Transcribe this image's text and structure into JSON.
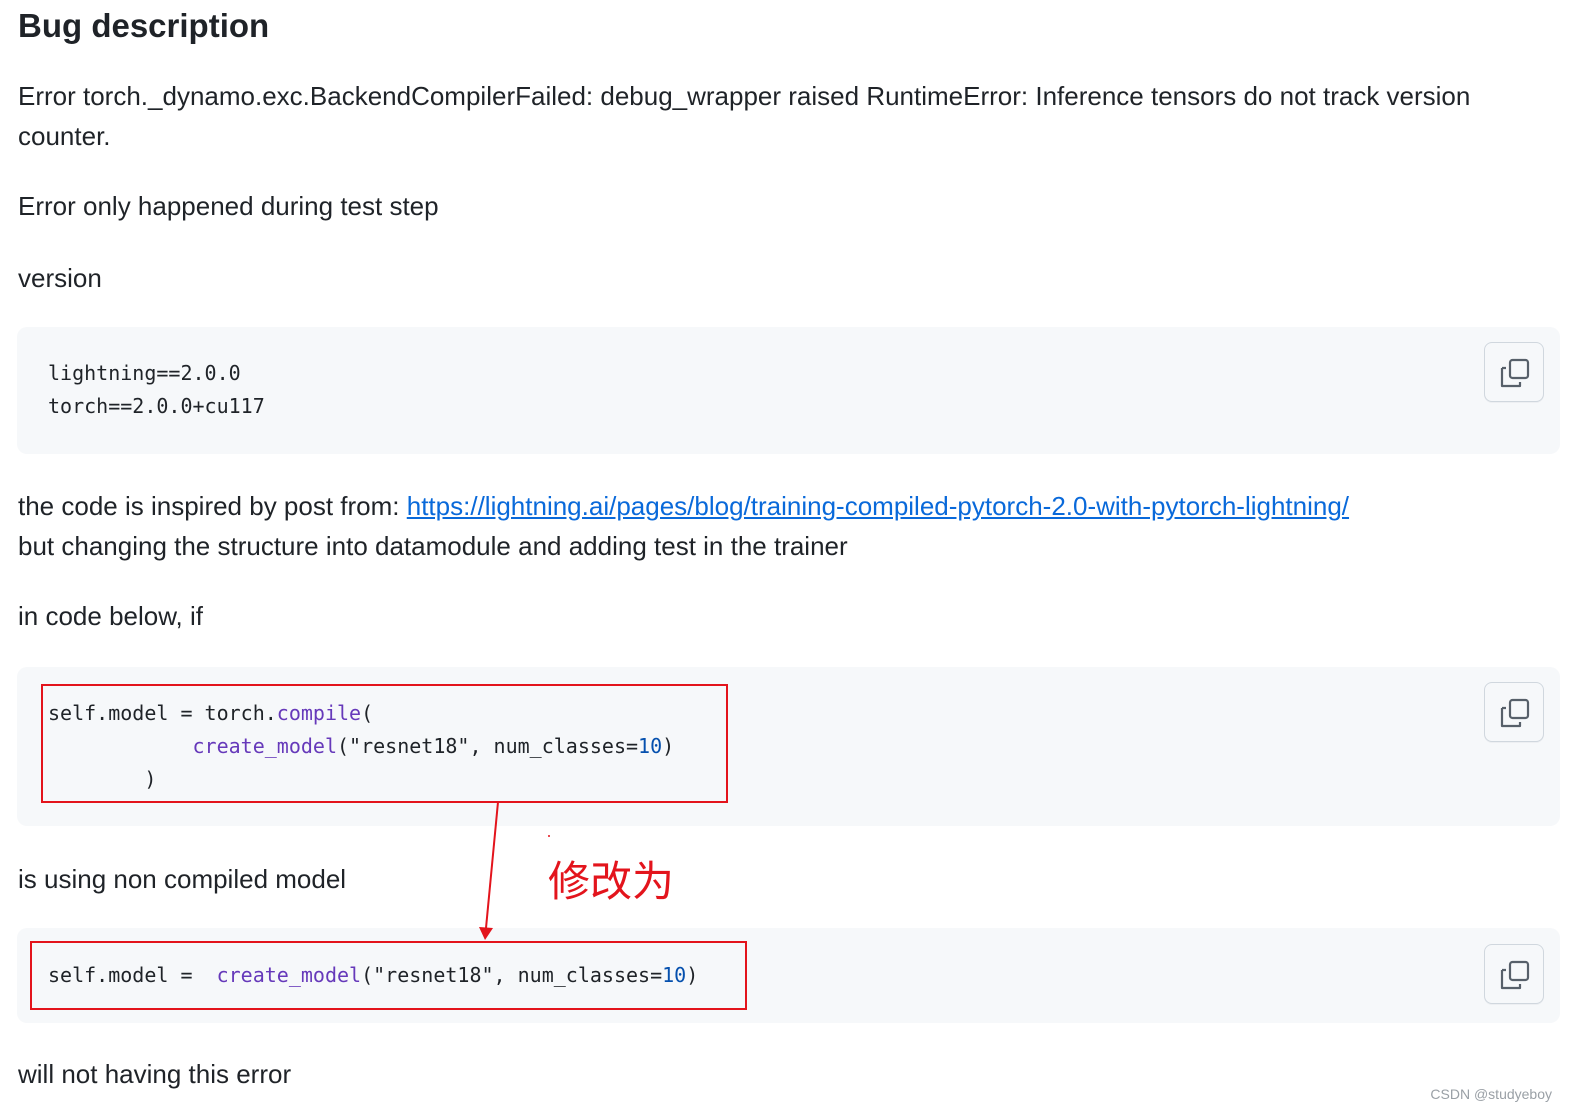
{
  "heading": "Bug description",
  "para_error_line1": "Error torch._dynamo.exc.BackendCompilerFailed: debug_wrapper raised RuntimeError: Inference tensors do not track version",
  "para_error_line2": "counter.",
  "para_test_step": "Error only happened during test step",
  "para_version": "version",
  "version_code": {
    "line1": "lightning==2.0.0",
    "line2": "torch==2.0.0+cu117"
  },
  "inspired": {
    "prefix": "the code is inspired by post from: ",
    "link": "https://lightning.ai/pages/blog/training-compiled-pytorch-2.0-with-pytorch-lightning/",
    "line2": "but changing the structure into datamodule and adding test in the trainer"
  },
  "para_in_code": "in code below, if",
  "compiled_code": {
    "l1_a": "self.model = torch.",
    "l1_fn": "compile",
    "l1_b": "(",
    "l2_indent": "            ",
    "l2_fn": "create_model",
    "l2_a": "(\"resnet18\", num_classes=",
    "l2_num": "10",
    "l2_b": ")",
    "l3": "        )"
  },
  "para_non_compiled": "is using non compiled model",
  "annotation": "修改为",
  "fixed_code": {
    "a": "self.model =  ",
    "fn": "create_model",
    "b": "(\"resnet18\", num_classes=",
    "num": "10",
    "c": ")"
  },
  "para_no_error": "will not having this error",
  "watermark": "CSDN @studyeboy",
  "colors": {
    "annotation_red": "#e3141c",
    "link_blue": "#0969da",
    "code_bg": "#f6f8fa",
    "function_purple": "#6639ba",
    "number_blue": "#0550ae"
  },
  "icons": [
    "copy-icon",
    "copy-icon",
    "copy-icon"
  ]
}
